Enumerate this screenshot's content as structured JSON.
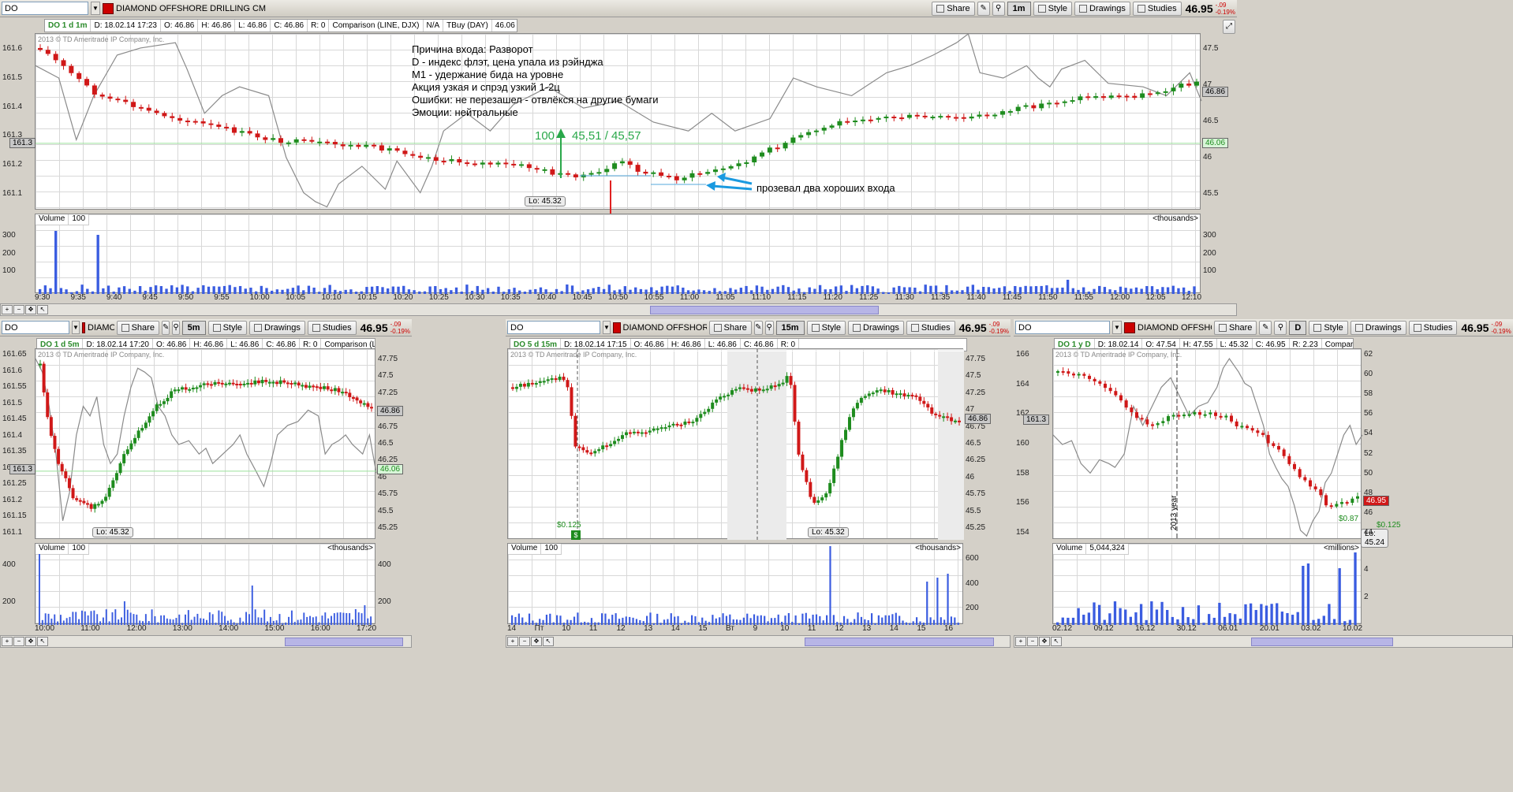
{
  "top": {
    "symbol": "DO",
    "company": "DIAMOND OFFSHORE DRILLING CM",
    "share": "Share",
    "aggregation": "1m",
    "style": "Style",
    "drawings": "Drawings",
    "studies": "Studies",
    "last": "46.95",
    "change": "-.09",
    "change_pct": "-0.19%",
    "info": [
      "DO 1 d 1m",
      "D: 18.02.14 17:23",
      "O: 46.86",
      "H: 46.86",
      "L: 46.86",
      "C: 46.86",
      "R: 0",
      "Comparison (LINE, DJX)",
      "N/A",
      "TBuy (DAY)",
      "46.06"
    ],
    "copyright": "2013 © TD Ameritrade IP Company, Inc.",
    "left_axis": [
      "161.6",
      "161.5",
      "161.4",
      "161.3",
      "161.2",
      "161.1"
    ],
    "right_axis": [
      "47.5",
      "47",
      "46.5",
      "46",
      "45.5"
    ],
    "left_badge": "161.3",
    "right_badge_price": "46.86",
    "right_badge_buy": "46.06",
    "lo_label": "Lo: 45.32",
    "annotation": [
      "Причина входа:  Разворот",
      "D - индекс флэт, цена упала из рэйнджа",
      "M1 - удержание бида на уровне",
      "Акция узкая и спрэд узкий 1-2ц",
      "Ошибки: не перезашел - отвлёкся на другие бумаги",
      "Эмоции:  нейтральные"
    ],
    "buy_size": "100",
    "buy_price": "45,51 / 45,57",
    "sell_size": "100",
    "missed_note": "прозевал два хороших входа",
    "volume_label": "Volume",
    "volume_value": "100",
    "volume_units": "<thousands>",
    "volume_axis": [
      "300",
      "200",
      "100"
    ],
    "time_labels": [
      "9:30",
      "9:35",
      "9:40",
      "9:45",
      "9:50",
      "9:55",
      "10:00",
      "10:05",
      "10:10",
      "10:15",
      "10:20",
      "10:25",
      "10:30",
      "10:35",
      "10:40",
      "10:45",
      "10:50",
      "10:55",
      "11:00",
      "11:05",
      "11:10",
      "11:15",
      "11:20",
      "11:25",
      "11:30",
      "11:35",
      "11:40",
      "11:45",
      "11:50",
      "11:55",
      "12:00",
      "12:05",
      "12:10"
    ]
  },
  "p5": {
    "symbol": "DO",
    "company": "DIAMOND OFFSHORE DRILLING CM",
    "share": "Share",
    "aggregation": "5m",
    "style": "Style",
    "drawings": "Drawings",
    "studies": "Studies",
    "last": "46.95",
    "change": "-.09",
    "change_pct": "-0.19%",
    "info": [
      "DO 1 d 5m",
      "D: 18.02.14 17:20",
      "O: 46.86",
      "H: 46.86",
      "L: 46.86",
      "C: 46.86",
      "R: 0",
      "Comparison (LINE, DJX)"
    ],
    "copyright": "2013 © TD Ameritrade IP Company, Inc.",
    "left_axis": [
      "161.65",
      "161.6",
      "161.55",
      "161.5",
      "161.45",
      "161.4",
      "161.35",
      "161.3",
      "161.25",
      "161.2",
      "161.15",
      "161.1"
    ],
    "right_axis": [
      "47.75",
      "47.5",
      "47.25",
      "47",
      "46.75",
      "46.5",
      "46.25",
      "46",
      "45.75",
      "45.5",
      "45.25"
    ],
    "left_badge": "161.3",
    "right_badge_price": "46.86",
    "right_badge_buy": "46.06",
    "lo_label": "Lo: 45.32",
    "volume_label": "Volume",
    "volume_value": "100",
    "volume_units": "<thousands>",
    "volume_axis": [
      "400",
      "200"
    ],
    "time_labels": [
      "10:00",
      "11:00",
      "12:00",
      "13:00",
      "14:00",
      "15:00",
      "16:00",
      "17:20"
    ]
  },
  "p15": {
    "symbol": "DO",
    "company": "DIAMOND OFFSHORE DRILLING CM",
    "share": "Share",
    "aggregation": "15m",
    "style": "Style",
    "drawings": "Drawings",
    "studies": "Studies",
    "last": "46.95",
    "change": "-.09",
    "change_pct": "-0.19%",
    "info": [
      "DO 5 d 15m",
      "D: 18.02.14 17:15",
      "O: 46.86",
      "H: 46.86",
      "L: 46.86",
      "C: 46.86",
      "R: 0"
    ],
    "copyright": "2013 © TD Ameritrade IP Company, Inc.",
    "right_axis": [
      "47.75",
      "47.5",
      "47.25",
      "47",
      "46.75",
      "46.5",
      "46.25",
      "46",
      "45.75",
      "45.5",
      "45.25"
    ],
    "right_badge_price": "46.86",
    "lo_label": "Lo: 45.32",
    "div_label": "$0.125",
    "volume_label": "Volume",
    "volume_value": "100",
    "volume_units": "<thousands>",
    "volume_axis": [
      "600",
      "400",
      "200"
    ],
    "time_labels": [
      "14",
      "Пт",
      "10",
      "11",
      "12",
      "13",
      "14",
      "15",
      "Вт",
      "9",
      "10",
      "11",
      "12",
      "13",
      "14",
      "15",
      "16"
    ]
  },
  "pD": {
    "symbol": "DO",
    "company": "DIAMOND OFFSHORE DRILLING CM",
    "share": "Share",
    "aggregation": "D",
    "style": "Style",
    "drawings": "Drawings",
    "studies": "Studies",
    "last": "46.95",
    "change": "-.09",
    "change_pct": "-0.19%",
    "info": [
      "DO 1 y D",
      "D: 18.02.14",
      "O: 47.54",
      "H: 47.55",
      "L: 45.32",
      "C: 46.95",
      "R: 2.23",
      "Comparison (LINE, DJX)"
    ],
    "copyright": "2013 © TD Ameritrade IP Company, Inc.",
    "left_axis": [
      "166",
      "164",
      "162",
      "160",
      "158",
      "156",
      "154"
    ],
    "right_axis": [
      "62",
      "60",
      "58",
      "56",
      "54",
      "52",
      "50",
      "48",
      "46",
      "44"
    ],
    "left_badge": "161.3",
    "right_badge_price": "46.95",
    "lo_label": "Lo: 45.24",
    "div_label_1": "$0.87",
    "div_label_2": "$0.125",
    "year_label": "2013 year",
    "volume_label": "Volume",
    "volume_value": "5,044,324",
    "volume_units": "<millions>",
    "volume_axis": [
      "4",
      "2"
    ],
    "time_labels": [
      "02.12",
      "09.12",
      "16.12",
      "30.12",
      "06.01",
      "20.01",
      "03.02",
      "10.02"
    ]
  },
  "colors": {
    "up": "#1e8c1e",
    "down": "#d01818",
    "volume": "#3a5ce0",
    "comparison": "#8a8a8a",
    "annotation_green": "#2aa84a",
    "annotation_red": "#e02020",
    "arrow_blue": "#1a9ae0"
  }
}
